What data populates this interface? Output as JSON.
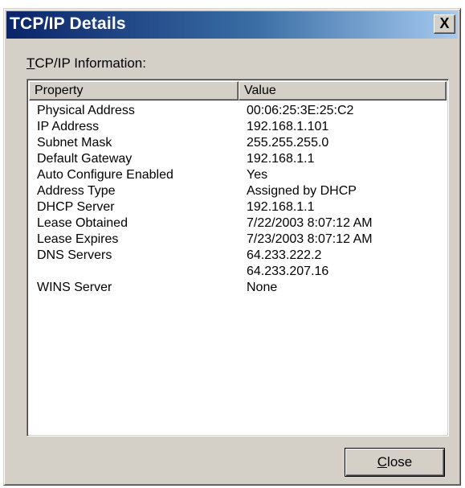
{
  "window": {
    "title": "TCP/IP Details",
    "close_glyph": "X"
  },
  "group": {
    "label_accel": "T",
    "label_rest": "CP/IP Information:"
  },
  "listview": {
    "columns": [
      "Property",
      "Value"
    ],
    "rows": [
      {
        "property": "Physical Address",
        "value": "00:06:25:3E:25:C2"
      },
      {
        "property": "IP Address",
        "value": "192.168.1.101"
      },
      {
        "property": "Subnet Mask",
        "value": "255.255.255.0"
      },
      {
        "property": "Default Gateway",
        "value": "192.168.1.1"
      },
      {
        "property": "Auto Configure Enabled",
        "value": "Yes"
      },
      {
        "property": "Address Type",
        "value": "Assigned by DHCP"
      },
      {
        "property": "DHCP Server",
        "value": "192.168.1.1"
      },
      {
        "property": "Lease Obtained",
        "value": "7/22/2003 8:07:12 AM"
      },
      {
        "property": "Lease Expires",
        "value": "7/23/2003 8:07:12 AM"
      },
      {
        "property": "DNS Servers",
        "value": "64.233.222.2"
      },
      {
        "property": "",
        "value": "64.233.207.16"
      },
      {
        "property": "WINS Server",
        "value": "None"
      }
    ]
  },
  "buttons": {
    "close_accel": "C",
    "close_rest": "lose"
  },
  "colors": {
    "title_start": "#0a246a",
    "title_end": "#a6caf0",
    "face": "#d4d0c8"
  }
}
